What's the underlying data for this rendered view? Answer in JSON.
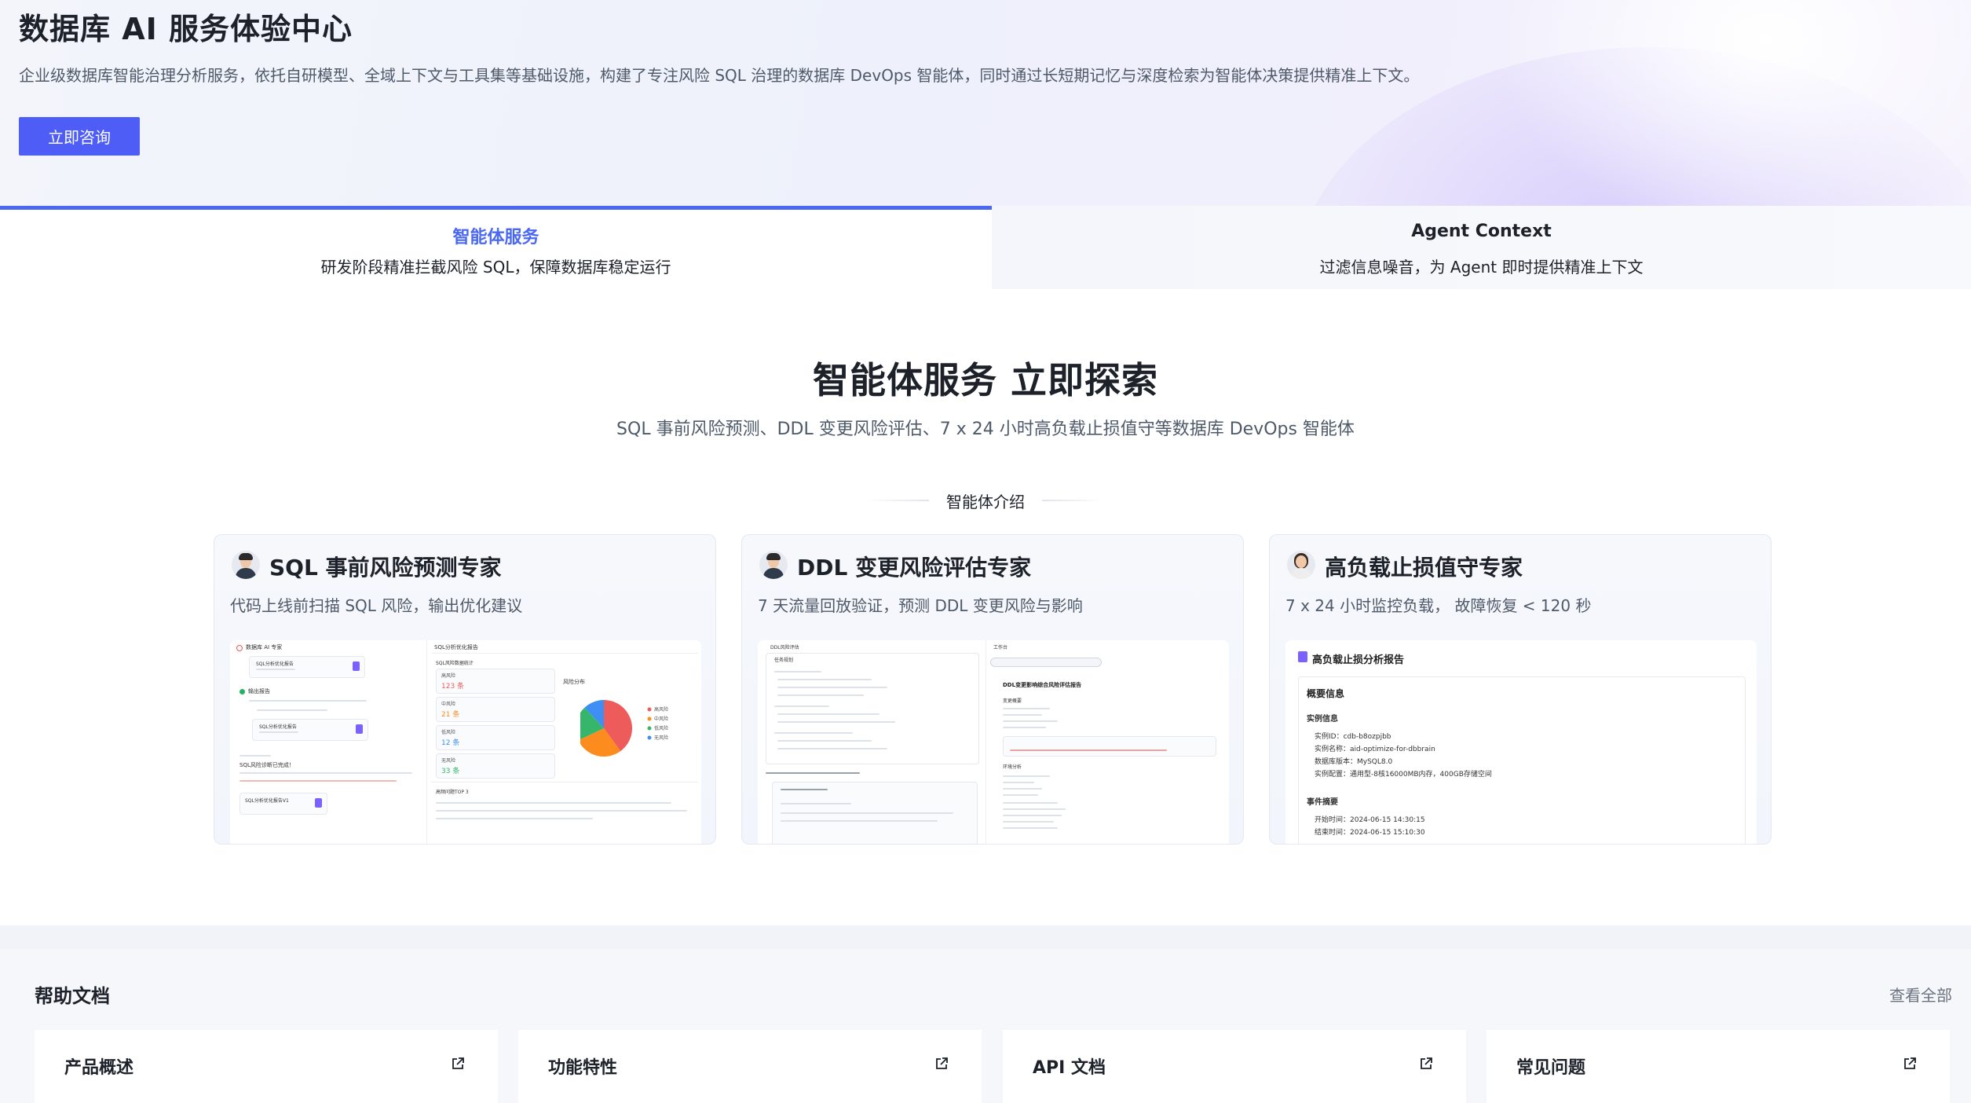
{
  "hero": {
    "title": "数据库 AI 服务体验中心",
    "description": "企业级数据库智能治理分析服务，依托自研模型、全域上下文与工具集等基础设施，构建了专注风险 SQL 治理的数据库 DevOps 智能体，同时通过长短期记忆与深度检索为智能体决策提供精准上下文。",
    "cta_label": "立即咨询"
  },
  "tabs": [
    {
      "title": "智能体服务",
      "subtitle": "研发阶段精准拦截风险 SQL，保障数据库稳定运行",
      "active": true
    },
    {
      "title": "Agent Context",
      "subtitle": "过滤信息噪音，为 Agent 即时提供精准上下文",
      "active": false
    }
  ],
  "section": {
    "title": "智能体服务 立即探索",
    "subtitle": "SQL 事前风险预测、DDL 变更风险评估、7 x 24 小时高负载止损值守等数据库 DevOps 智能体",
    "divider_label": "智能体介绍"
  },
  "cards": [
    {
      "title": "SQL 事前风险预测专家",
      "description": "代码上线前扫描 SQL 风险，输出优化建议",
      "avatar": "male-avatar"
    },
    {
      "title": "DDL 变更风险评估专家",
      "description": "7 天流量回放验证，预测 DDL 变更风险与影响",
      "avatar": "male-avatar"
    },
    {
      "title": "高负载止损值守专家",
      "description": "7 x 24 小时监控负载， 故障恢复 < 120 秒",
      "avatar": "female-avatar"
    }
  ],
  "preview1": {
    "left_header": "数据库 AI 专家",
    "file1": "SQL分析优化报告",
    "step": "输出报告",
    "file2": "SQL分析优化报告",
    "note": "SQL风险诊断已完成！",
    "file3": "SQL分析优化报告V1",
    "right_header": "SQL分析优化报告",
    "stats_title": "SQL风险数据统计",
    "stats": [
      {
        "label": "高风险",
        "value": "123",
        "unit": "条"
      },
      {
        "label": "中风险",
        "value": "21",
        "unit": "条"
      },
      {
        "label": "低风险",
        "value": "12",
        "unit": "条"
      },
      {
        "label": "无风险",
        "value": "33",
        "unit": "条"
      }
    ],
    "chart_title": "风险分布",
    "chart_data": {
      "type": "pie",
      "categories": [
        "高风险",
        "中风险",
        "低风险",
        "无风险"
      ],
      "values": [
        40,
        28,
        20,
        12
      ],
      "colors": [
        "#ee5b5b",
        "#fb8c1d",
        "#35b66b",
        "#3f8ef4"
      ]
    },
    "bottom_title": "高频问题TOP 3"
  },
  "preview2": {
    "header": "DDL风险评估",
    "section_a": "任务规划",
    "right_tab": "工作台",
    "report_title": "DDL变更影响综合风险评估报告",
    "sub1": "变更概要",
    "sub2": "环境分析"
  },
  "preview3": {
    "report_title": "高负载止损分析报告",
    "summary_title": "概要信息",
    "instance_title": "实例信息",
    "instance_items": [
      "实例ID：cdb-b8ozpjbb",
      "实例名称：aid-optimize-for-dbbrain",
      "数据库版本：MySQL8.0",
      "实例配置：通用型-8核16000MB内存，400GB存储空间"
    ],
    "event_title": "事件摘要",
    "event_items": [
      "开始时间：2024-06-15 14:30:15",
      "结束时间：2024-06-15 15:10:30"
    ]
  },
  "help": {
    "title": "帮助文档",
    "view_all": "查看全部",
    "docs": [
      "产品概述",
      "功能特性",
      "API 文档",
      "常见问题"
    ]
  },
  "colors": {
    "accent": "#4a68f2",
    "button": "#4d5df5"
  }
}
